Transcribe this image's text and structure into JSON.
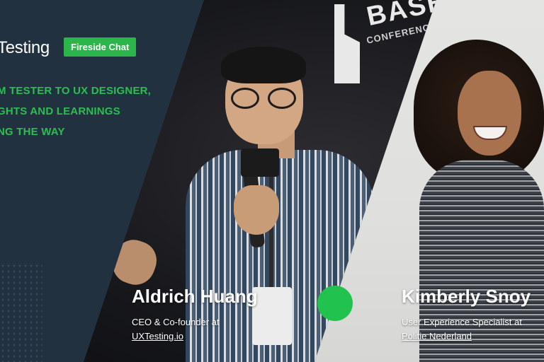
{
  "brand": {
    "name": "Testing"
  },
  "tag": {
    "label": "Fireside Chat"
  },
  "headline": {
    "lines": [
      "M TESTER TO UX DESIGNER,",
      "GHTS AND LEARNINGS",
      "NG THE WAY"
    ]
  },
  "backdrop": {
    "logo_word": "BASE",
    "logo_sub": "CONFERENCE"
  },
  "speakers": [
    {
      "name": "Aldrich Huang",
      "role": "CEO & Co-founder at",
      "org": "UXTesting.io"
    },
    {
      "name": "Kimberly Snoy",
      "role": "User Experience Specialist at",
      "org": "Politie Nederland"
    }
  ],
  "colors": {
    "accent_green": "#2bb54a",
    "panel_dark": "#223140"
  }
}
